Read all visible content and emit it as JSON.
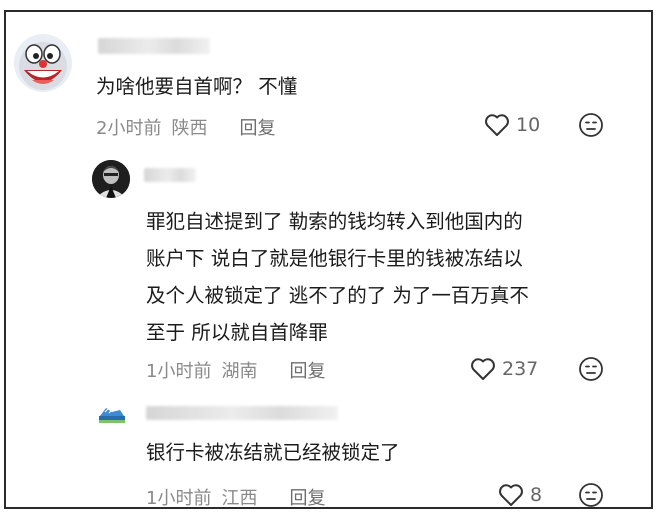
{
  "comments": [
    {
      "text": "为啥他要自首啊？ 不懂",
      "time": "2小时前",
      "location": "陕西",
      "reply_label": "回复",
      "likes": "10"
    },
    {
      "lines": [
        "罪犯自述提到了 勒索的钱均转入到他国内的",
        "账户下 说白了就是他银行卡里的钱被冻结以",
        "及个人被锁定了 逃不了的了 为了一百万真不",
        "至于 所以就自首降罪"
      ],
      "time": "1小时前",
      "location": "湖南",
      "reply_label": "回复",
      "likes": "237"
    },
    {
      "text": "银行卡被冻结就已经被锁定了",
      "time": "1小时前",
      "location": "江西",
      "reply_label": "回复",
      "likes": "8"
    }
  ]
}
